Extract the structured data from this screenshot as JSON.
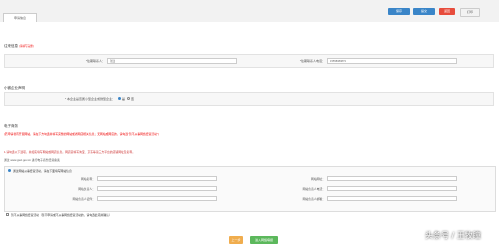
{
  "tabs": {
    "active": "申请信息"
  },
  "toolbar": {
    "save": "保存",
    "submit": "提交",
    "back": "返回",
    "print": "打印"
  },
  "sections": {
    "applicant": {
      "title": "往来信息",
      "note": "(请填写完整)",
      "contact_name_label": "*往期联系人：",
      "contact_name_value": "张四",
      "contact_phone_label": "*往期联系人电话：",
      "contact_phone_value": "15558080873"
    },
    "enterprise": {
      "title": "小微企业声明",
      "question": "* 本企业是否属小型企业或微型企业：",
      "opt_yes": "是",
      "opt_no": "否"
    },
    "website": {
      "title": "电子商务",
      "notice1": "(若申请者有开展网站，请在下方勾选并填写完整的网站或者网店相关信息；无网站或网店的，请勾选“暂不从事网络经营活动”)",
      "notice2": "1.请勾选以下选项，并如实填写网站或网店信息。网店需填写淘宝、京东等第三方平台的店铺网址及名称。",
      "notice3": "通过 www.gsxt.gov.cn 进行电子商务经营备案",
      "opt_has_site": "通过网站从事经营活动，请在下面填写网站信息",
      "site_name_label": "网站名称：",
      "site_url_label": "网站网址：",
      "site_owner_label": "网站负责人：",
      "site_phone_label": "网站负责人电话：",
      "site_id_label": "网站负责人证件：",
      "site_email_label": "网站负责人邮箱：",
      "opt_no_site": "暂不从事网络经营活动（暂不申请或不从事网络经营活动的，请勾选此项并确认）"
    }
  },
  "footer": {
    "prev": "上一步",
    "next": "进入网络填报"
  },
  "watermark": "头条号 / 王牧瞳"
}
